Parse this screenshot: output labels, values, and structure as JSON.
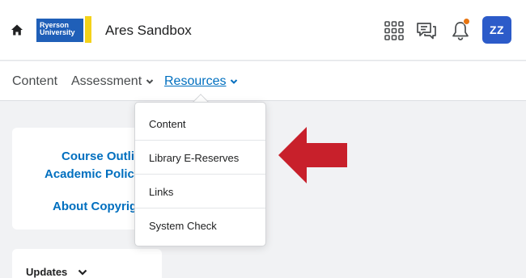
{
  "header": {
    "logo_line1": "Ryerson",
    "logo_line2": "University",
    "org_title": "Ares Sandbox",
    "avatar_initials": "ZZ",
    "icons": [
      "home-icon",
      "apps-grid-icon",
      "messages-icon",
      "notifications-icon"
    ],
    "colors": {
      "logo_blue": "#1f5fb8",
      "logo_yellow": "#f4d21a",
      "avatar": "#2c5bc9",
      "notification_dot": "#e87511"
    }
  },
  "nav": {
    "items": [
      {
        "label": "Content"
      },
      {
        "label": "Assessment"
      },
      {
        "label": "Resources"
      }
    ],
    "active_color": "#006fbf"
  },
  "resources_menu": {
    "items": [
      {
        "label": "Content"
      },
      {
        "label": "Library E-Reserves"
      },
      {
        "label": "Links"
      },
      {
        "label": "System Check"
      }
    ]
  },
  "widgets": {
    "course_links": [
      "Course Outli",
      "Academic Polici",
      "About Copyrig"
    ],
    "updates_title": "Updates"
  },
  "annotation": {
    "arrow_color": "#c8202b"
  }
}
